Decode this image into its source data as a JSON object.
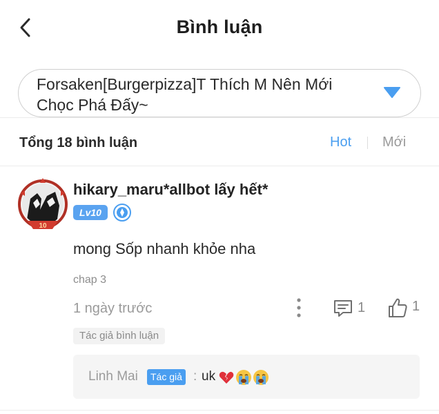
{
  "header": {
    "title": "Bình luận"
  },
  "chapter_select": {
    "value": "Forsaken[Burgerpizza]T Thích M Nên Mới Chọc Phá Đấy~"
  },
  "comments_bar": {
    "total_label": "Tổng 18 bình luận",
    "sort_hot": "Hot",
    "sort_new": "Mới"
  },
  "comment": {
    "username": "hikary_maru*allbot lấy hết*",
    "level": "Lv10",
    "level_color": "#5aa3f0",
    "rank_icon": "diamond-rank-icon",
    "avatar_text": "10",
    "body": "mong Sốp nhanh khỏe nha",
    "chapter": "chap 3",
    "time": "1 ngày trước",
    "reply_count": "1",
    "like_count": "1",
    "author_tag": "Tác giả bình luận",
    "reply": {
      "author": "Linh Mai",
      "author_badge": "Tác giả",
      "separator": ":",
      "text": "uk",
      "emojis": [
        "broken-heart-emoji",
        "crying-face-emoji",
        "crying-face-emoji"
      ]
    }
  },
  "colors": {
    "accent": "#4a9ef0",
    "muted": "#9a9a9a",
    "avatar_ring": "#c0392b"
  }
}
